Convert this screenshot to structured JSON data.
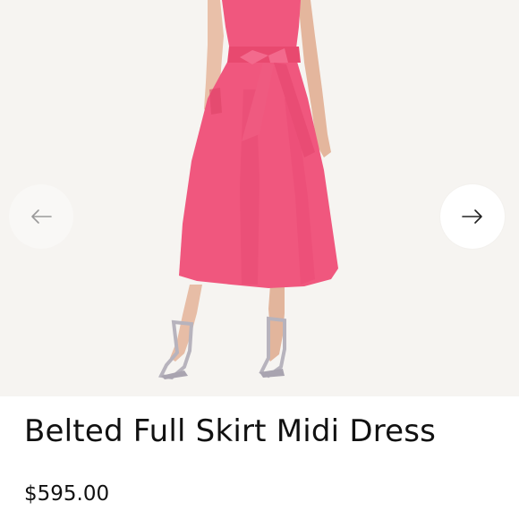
{
  "product": {
    "title": "Belted Full Skirt Midi Dress",
    "price": "$595.00"
  },
  "gallery": {
    "image_alt": "Model wearing a pink sleeveless belted full skirt midi dress with silver strappy heels",
    "prev_icon": "arrow-left-icon",
    "next_icon": "arrow-right-icon"
  },
  "colors": {
    "dress": "#f0577e",
    "background": "#f6f4f1",
    "text": "#111111"
  }
}
